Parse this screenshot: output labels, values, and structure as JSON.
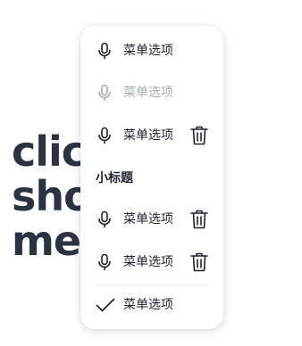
{
  "background": {
    "title_line1": "click to show",
    "title_line2": "menu"
  },
  "menu": {
    "items": [
      {
        "label": "菜单选项",
        "icon": "microphone-icon",
        "disabled": false,
        "trailing": null
      },
      {
        "label": "菜单选项",
        "icon": "microphone-icon",
        "disabled": true,
        "trailing": null
      },
      {
        "label": "菜单选项",
        "icon": "microphone-icon",
        "disabled": false,
        "trailing": "trash-icon"
      }
    ],
    "section_title": "小标题",
    "section_items": [
      {
        "label": "菜单选项",
        "icon": "microphone-icon",
        "trailing": "trash-icon"
      },
      {
        "label": "菜单选项",
        "icon": "microphone-icon",
        "trailing": "trash-icon"
      }
    ],
    "footer_item": {
      "label": "菜单选项",
      "icon": "check-icon"
    }
  },
  "colors": {
    "text": "#1f2430",
    "disabled": "#a8acb3",
    "title": "#2b3342"
  }
}
